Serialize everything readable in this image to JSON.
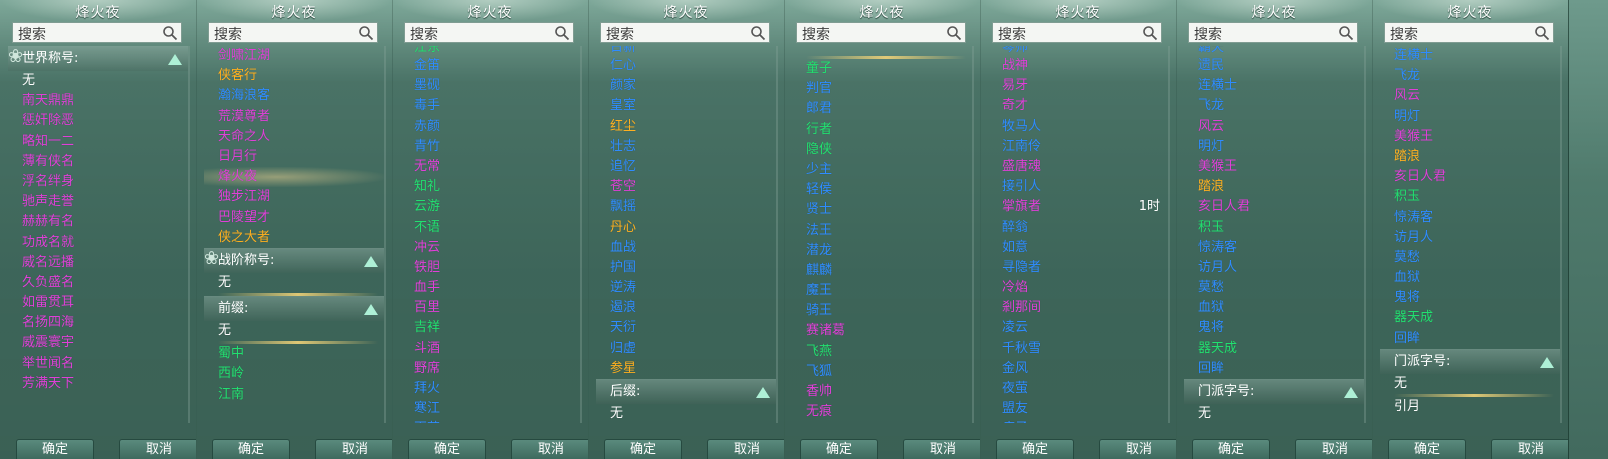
{
  "panels": [
    {
      "title": "烽火夜",
      "search_placeholder": "搜索",
      "sections": [
        {
          "header": "世界称号:",
          "swirl": true,
          "items": [
            {
              "t": "无",
              "c": "w"
            },
            {
              "t": "南天鼎鼎",
              "c": "m"
            },
            {
              "t": "惩奸除恶",
              "c": "m"
            },
            {
              "t": "略知一二",
              "c": "m"
            },
            {
              "t": "薄有侠名",
              "c": "m"
            },
            {
              "t": "浮名绊身",
              "c": "m"
            },
            {
              "t": "驰声走誉",
              "c": "m"
            },
            {
              "t": "赫赫有名",
              "c": "m"
            },
            {
              "t": "功成名就",
              "c": "m"
            },
            {
              "t": "威名远播",
              "c": "m"
            },
            {
              "t": "久负盛名",
              "c": "m"
            },
            {
              "t": "如雷贯耳",
              "c": "m"
            },
            {
              "t": "名扬四海",
              "c": "m"
            },
            {
              "t": "威震寰宇",
              "c": "m"
            },
            {
              "t": "举世闻名",
              "c": "m"
            },
            {
              "t": "芳满天下",
              "c": "m"
            }
          ]
        }
      ],
      "ok": "确定",
      "cancel": "取消"
    },
    {
      "title": "烽火夜",
      "search_placeholder": "搜索",
      "sections": [
        {
          "header": "",
          "items": [
            {
              "t": "剑啸江湖",
              "c": "m"
            },
            {
              "t": "侠客行",
              "c": "o"
            },
            {
              "t": "瀚海浪客",
              "c": "b"
            },
            {
              "t": "荒漠尊者",
              "c": "m"
            },
            {
              "t": "天命之人",
              "c": "m"
            },
            {
              "t": "日月行",
              "c": "m"
            },
            {
              "t": "烽火夜",
              "c": "m",
              "sel": true
            },
            {
              "t": "独步江湖",
              "c": "m"
            },
            {
              "t": "巴陵望才",
              "c": "m"
            },
            {
              "t": "侠之大者",
              "c": "o"
            }
          ]
        },
        {
          "header": "战阶称号:",
          "swirl": true,
          "items": [
            {
              "t": "无",
              "c": "w",
              "line": true
            }
          ]
        },
        {
          "header": "前缀:",
          "items": [
            {
              "t": "无",
              "c": "w",
              "line": true
            },
            {
              "t": "蜀中",
              "c": "g"
            },
            {
              "t": "西岭",
              "c": "g"
            },
            {
              "t": "江南",
              "c": "g"
            }
          ]
        }
      ],
      "ok": "确定",
      "cancel": "取消"
    },
    {
      "title": "烽火夜",
      "search_placeholder": "搜索",
      "sections": [
        {
          "header": "",
          "items": [
            {
              "t": "江东",
              "c": "g",
              "half": true
            },
            {
              "t": "金笛",
              "c": "b"
            },
            {
              "t": "墨砚",
              "c": "b"
            },
            {
              "t": "毒手",
              "c": "b"
            },
            {
              "t": "赤颜",
              "c": "b"
            },
            {
              "t": "青竹",
              "c": "b"
            },
            {
              "t": "无常",
              "c": "m"
            },
            {
              "t": "知礼",
              "c": "g"
            },
            {
              "t": "云游",
              "c": "g"
            },
            {
              "t": "不语",
              "c": "g"
            },
            {
              "t": "冲云",
              "c": "m"
            },
            {
              "t": "铁胆",
              "c": "m"
            },
            {
              "t": "血手",
              "c": "m"
            },
            {
              "t": "百里",
              "c": "m"
            },
            {
              "t": "吉祥",
              "c": "g"
            },
            {
              "t": "斗酒",
              "c": "m"
            },
            {
              "t": "野席",
              "c": "m"
            },
            {
              "t": "拜火",
              "c": "b"
            },
            {
              "t": "寒江",
              "c": "b"
            },
            {
              "t": "百花",
              "c": "b"
            }
          ]
        }
      ],
      "ok": "确定",
      "cancel": "取消"
    },
    {
      "title": "烽火夜",
      "search_placeholder": "搜索",
      "sections": [
        {
          "header": "",
          "items": [
            {
              "t": "日新",
              "c": "b",
              "half": true
            },
            {
              "t": "仁心",
              "c": "b"
            },
            {
              "t": "颜家",
              "c": "b"
            },
            {
              "t": "皇室",
              "c": "b"
            },
            {
              "t": "红尘",
              "c": "o"
            },
            {
              "t": "壮志",
              "c": "b"
            },
            {
              "t": "追忆",
              "c": "b"
            },
            {
              "t": "苍空",
              "c": "m"
            },
            {
              "t": "飘摇",
              "c": "b"
            },
            {
              "t": "丹心",
              "c": "o"
            },
            {
              "t": "血战",
              "c": "b"
            },
            {
              "t": "护国",
              "c": "b"
            },
            {
              "t": "逆涛",
              "c": "b"
            },
            {
              "t": "遏浪",
              "c": "b"
            },
            {
              "t": "天衍",
              "c": "b"
            },
            {
              "t": "归虚",
              "c": "b"
            },
            {
              "t": "参星",
              "c": "o"
            }
          ]
        },
        {
          "header": "后缀:",
          "items": [
            {
              "t": "无",
              "c": "w",
              "line": true
            }
          ]
        }
      ],
      "ok": "确定",
      "cancel": "取消"
    },
    {
      "title": "烽火夜",
      "search_placeholder": "搜索",
      "sections": [
        {
          "header": "",
          "items": [
            {
              "t": "",
              "c": "w",
              "line": true,
              "half": true
            },
            {
              "t": "童子",
              "c": "g"
            },
            {
              "t": "判官",
              "c": "b"
            },
            {
              "t": "郎君",
              "c": "b"
            },
            {
              "t": "行者",
              "c": "g"
            },
            {
              "t": "隐侠",
              "c": "g"
            },
            {
              "t": "少主",
              "c": "b"
            },
            {
              "t": "轻侯",
              "c": "b"
            },
            {
              "t": "贤士",
              "c": "b"
            },
            {
              "t": "法王",
              "c": "b"
            },
            {
              "t": "潜龙",
              "c": "b"
            },
            {
              "t": "麒麟",
              "c": "b"
            },
            {
              "t": "魔王",
              "c": "b"
            },
            {
              "t": "骑王",
              "c": "b"
            },
            {
              "t": "赛诸葛",
              "c": "m"
            },
            {
              "t": "飞燕",
              "c": "g"
            },
            {
              "t": "飞狐",
              "c": "b"
            },
            {
              "t": "香帅",
              "c": "m"
            },
            {
              "t": "无痕",
              "c": "m"
            },
            {
              "t": "探花",
              "c": "b"
            }
          ]
        }
      ],
      "ok": "确定",
      "cancel": "取消"
    },
    {
      "title": "烽火夜",
      "search_placeholder": "搜索",
      "sections": [
        {
          "header": "",
          "items": [
            {
              "t": "琴师",
              "c": "b",
              "half": true
            },
            {
              "t": "战神",
              "c": "m"
            },
            {
              "t": "易牙",
              "c": "m"
            },
            {
              "t": "奇才",
              "c": "m"
            },
            {
              "t": "牧马人",
              "c": "b"
            },
            {
              "t": "江南伶",
              "c": "b"
            },
            {
              "t": "盛唐魂",
              "c": "m"
            },
            {
              "t": "接引人",
              "c": "b"
            },
            {
              "t": "掌旗者",
              "c": "m",
              "extra": "1时"
            },
            {
              "t": "醉翁",
              "c": "b"
            },
            {
              "t": "如意",
              "c": "b"
            },
            {
              "t": "寻隐者",
              "c": "b"
            },
            {
              "t": "冷焰",
              "c": "m"
            },
            {
              "t": "剎那间",
              "c": "m"
            },
            {
              "t": "凌云",
              "c": "b"
            },
            {
              "t": "千秋雪",
              "c": "b"
            },
            {
              "t": "金风",
              "c": "b"
            },
            {
              "t": "夜萤",
              "c": "b"
            },
            {
              "t": "盟友",
              "c": "b"
            },
            {
              "t": "疯子",
              "c": "b"
            }
          ]
        }
      ],
      "ok": "确定",
      "cancel": "取消"
    },
    {
      "title": "烽火夜",
      "search_placeholder": "搜索",
      "sections": [
        {
          "header": "",
          "items": [
            {
              "t": "霸天",
              "c": "b",
              "half": true
            },
            {
              "t": "遗民",
              "c": "b"
            },
            {
              "t": "连横士",
              "c": "b"
            },
            {
              "t": "飞龙",
              "c": "b"
            },
            {
              "t": "风云",
              "c": "m"
            },
            {
              "t": "明灯",
              "c": "b"
            },
            {
              "t": "美猴王",
              "c": "m"
            },
            {
              "t": "踏浪",
              "c": "o"
            },
            {
              "t": "亥日人君",
              "c": "m"
            },
            {
              "t": "积玉",
              "c": "g"
            },
            {
              "t": "惊涛客",
              "c": "b"
            },
            {
              "t": "访月人",
              "c": "b"
            },
            {
              "t": "莫愁",
              "c": "b"
            },
            {
              "t": "血狱",
              "c": "b"
            },
            {
              "t": "鬼将",
              "c": "b"
            },
            {
              "t": "器天成",
              "c": "g"
            },
            {
              "t": "回眸",
              "c": "b"
            }
          ]
        },
        {
          "header": "门派字号:",
          "items": [
            {
              "t": "无",
              "c": "w",
              "line": true
            }
          ]
        }
      ],
      "ok": "确定",
      "cancel": "取消"
    },
    {
      "title": "烽火夜",
      "search_placeholder": "搜索",
      "sections": [
        {
          "header": "",
          "items": [
            {
              "t": "连横士",
              "c": "b"
            },
            {
              "t": "飞龙",
              "c": "b"
            },
            {
              "t": "风云",
              "c": "m"
            },
            {
              "t": "明灯",
              "c": "b"
            },
            {
              "t": "美猴王",
              "c": "m"
            },
            {
              "t": "踏浪",
              "c": "o"
            },
            {
              "t": "亥日人君",
              "c": "m"
            },
            {
              "t": "积玉",
              "c": "g"
            },
            {
              "t": "惊涛客",
              "c": "b"
            },
            {
              "t": "访月人",
              "c": "b"
            },
            {
              "t": "莫愁",
              "c": "b"
            },
            {
              "t": "血狱",
              "c": "b"
            },
            {
              "t": "鬼将",
              "c": "b"
            },
            {
              "t": "器天成",
              "c": "g"
            },
            {
              "t": "回眸",
              "c": "b"
            }
          ]
        },
        {
          "header": "门派字号:",
          "items": [
            {
              "t": "无",
              "c": "w",
              "line": true
            },
            {
              "t": "引月",
              "c": "w"
            }
          ]
        }
      ],
      "ok": "确定",
      "cancel": "取消"
    }
  ]
}
